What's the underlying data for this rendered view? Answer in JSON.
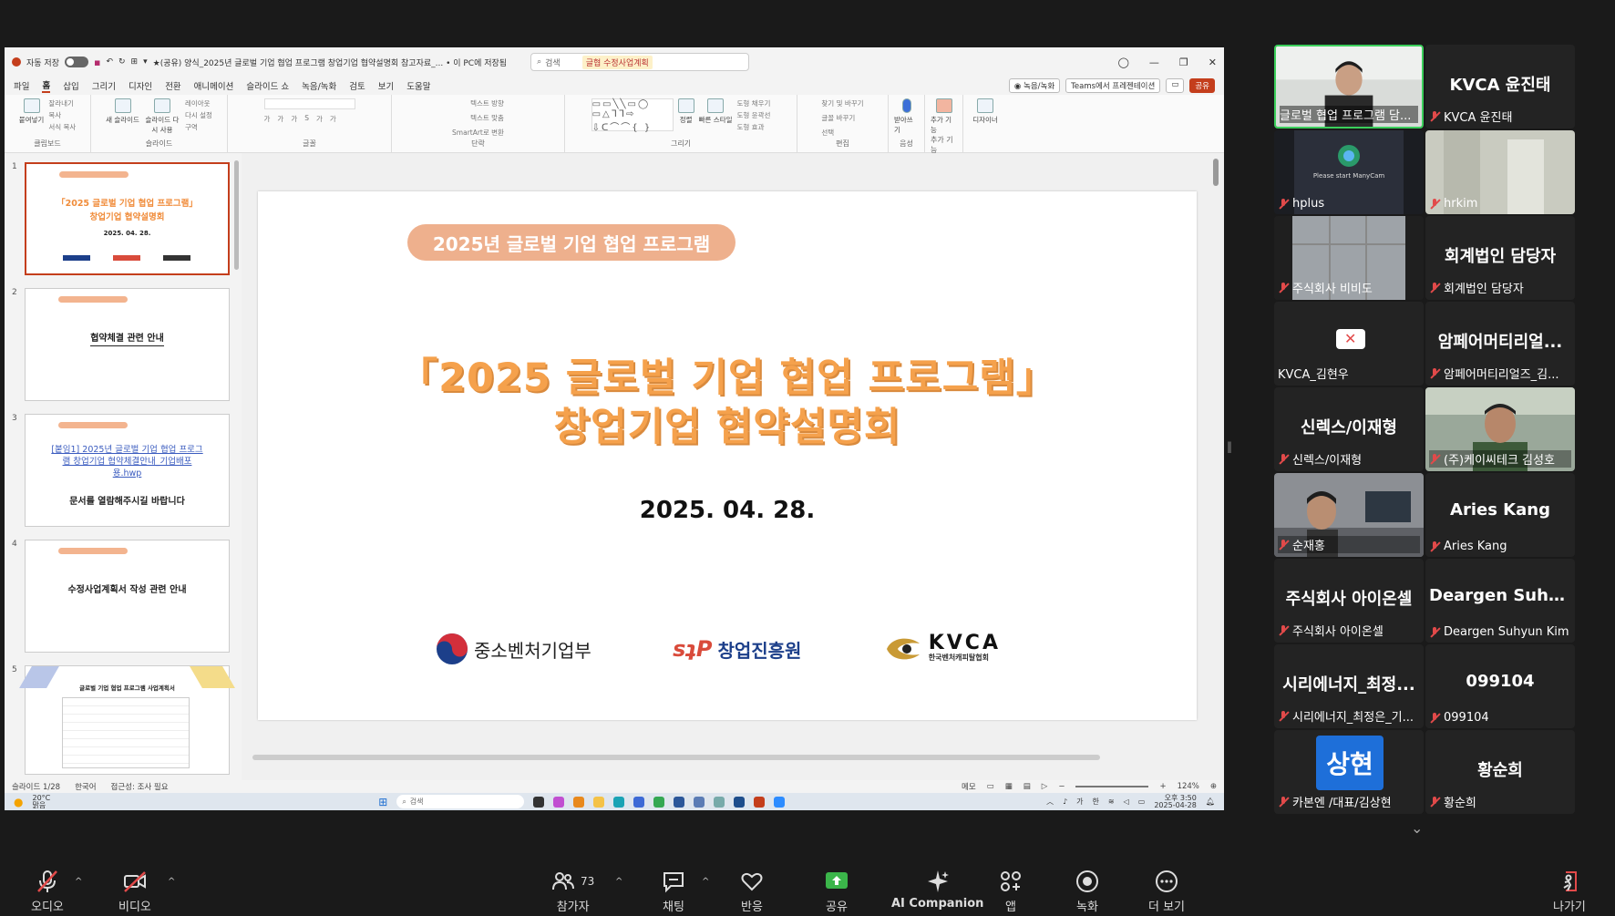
{
  "app": {
    "autosave_label": "자동 저장",
    "autosave_state": "끔",
    "doc_title": "★(공유) 양식_2025년 글로벌 기업 협업 프로그램 창업기업 협약설명회 참고자료_... • 이 PC에 저장됨",
    "search_placeholder": "검색",
    "search_tag": "글협 수정사업계획",
    "menu": [
      "파일",
      "홈",
      "삽입",
      "그리기",
      "디자인",
      "전환",
      "애니메이션",
      "슬라이드 쇼",
      "녹음/녹화",
      "검토",
      "보기",
      "도움말"
    ],
    "menu_active": "홈",
    "record_btn": "◉ 녹음/녹화",
    "teams_btn": "Teams에서 프레젠테이션",
    "share_btn": "공유"
  },
  "ribbon": {
    "groups": [
      {
        "name": "클립보드",
        "items": [
          "붙여넣기",
          "잘라내기",
          "복사",
          "서식 복사"
        ]
      },
      {
        "name": "슬라이드",
        "items": [
          "새 슬라이드",
          "슬라이드 다시 사용",
          "레이아웃",
          "다시 설정",
          "구역"
        ]
      },
      {
        "name": "글꼴",
        "items": [
          "가",
          "가",
          "가",
          "S",
          "가",
          "가"
        ]
      },
      {
        "name": "단락",
        "items": [
          "텍스트 방향",
          "텍스트 맞춤",
          "SmartArt로 변환"
        ]
      },
      {
        "name": "그리기",
        "items": [
          "정렬",
          "빠른 스타일",
          "도형 채우기",
          "도형 윤곽선",
          "도형 효과"
        ]
      },
      {
        "name": "편집",
        "items": [
          "찾기 및 바꾸기",
          "글꼴 바꾸기",
          "선택"
        ]
      },
      {
        "name": "음성",
        "items": [
          "받아쓰기"
        ]
      },
      {
        "name": "추가 기능",
        "items": [
          "추가 기능"
        ]
      },
      {
        "name": "",
        "items": [
          "디자이너"
        ]
      }
    ]
  },
  "thumbnails": [
    {
      "num": "1",
      "lines": [
        "「2025 글로벌 기업 협업 프로그램」",
        "창업기업 협약설명회"
      ],
      "date": "2025. 04. 28."
    },
    {
      "num": "2",
      "lines": [
        "협약체결 관련 안내"
      ]
    },
    {
      "num": "3",
      "link": "[붙임1] 2025년 글로벌 기업 협업 프로그램 창업기업 협약체결안내_기업배포용.hwp",
      "lines": [
        "문서를 열람해주시길 바랍니다"
      ]
    },
    {
      "num": "4",
      "lines": [
        "수정사업계획서 작성 관련 안내"
      ]
    },
    {
      "num": "5",
      "lines": [
        "글로벌 기업 협업 프로그램 사업계획서"
      ]
    }
  ],
  "slide": {
    "pill": "2025년 글로벌 기업 협업 프로그램",
    "title_line1": "「2025 글로벌 기업 협업 프로그램」",
    "title_line2": "창업기업 협약설명회",
    "date": "2025. 04. 28.",
    "logos": [
      "중소벤처기업부",
      "창업진흥원",
      "KVCA",
      "한국벤처캐피탈협회"
    ]
  },
  "statusbar": {
    "slide_count": "슬라이드 1/28",
    "language": "한국어",
    "accessibility": "접근성: 조사 필요",
    "notes": "메모",
    "zoom": "124%"
  },
  "taskbar": {
    "weather_temp": "20°C",
    "weather_desc": "맑음",
    "search_placeholder": "검색",
    "ime1": "가",
    "ime2": "한",
    "time": "오후 3:50",
    "date": "2025-04-28"
  },
  "participants": [
    {
      "name": "글로벌 협업 프로그램 담...",
      "big": "",
      "video": true,
      "active": true
    },
    {
      "name": "KVCA 윤진태",
      "big": "KVCA 윤진태"
    },
    {
      "name": "hplus",
      "big": "",
      "video": true,
      "manycam": "Please start ManyCam"
    },
    {
      "name": "hrkim",
      "big": "",
      "video": true
    },
    {
      "name": "주식회사 비비도",
      "big": "",
      "video": true
    },
    {
      "name": "회계법인 담당자",
      "big": "회계법인 담당자"
    },
    {
      "name": "KVCA_김현우",
      "big": "",
      "camoff": true
    },
    {
      "name": "암페어머티리얼즈_김...",
      "big": "암페어머티리얼..."
    },
    {
      "name": "신렉스/이재형",
      "big": "신렉스/이재형"
    },
    {
      "name": "(주)케이씨테크 김성호",
      "big": "",
      "video": true
    },
    {
      "name": "순재홍",
      "big": "",
      "video": true
    },
    {
      "name": "Aries Kang",
      "big": "Aries Kang"
    },
    {
      "name": "주식회사 아이온셀",
      "big": "주식회사 아이온셀"
    },
    {
      "name": "Deargen Suhyun Kim",
      "big": "Deargen Suhyu..."
    },
    {
      "name": "시리에너지_최정은_기...",
      "big": "시리에너지_최정..."
    },
    {
      "name": "099104",
      "big": "099104"
    },
    {
      "name": "카본엔 /대표/김상현",
      "big": "",
      "avatar": "상현"
    },
    {
      "name": "황순희",
      "big": "황순희"
    }
  ],
  "toolbar": {
    "audio": "오디오",
    "video": "비디오",
    "participants": "참가자",
    "participant_count": "73",
    "chat": "채팅",
    "reactions": "반응",
    "share": "공유",
    "ai": "AI Companion",
    "apps": "앱",
    "record": "녹화",
    "more": "더 보기",
    "leave": "나가기"
  },
  "colors": {
    "accent": "#c43e1c",
    "slide_orange": "#f5a14c",
    "pill": "#eeb08d",
    "active_speaker": "#3bcf5b",
    "mute_red": "#e24a4a",
    "share_green": "#3bb54a"
  }
}
